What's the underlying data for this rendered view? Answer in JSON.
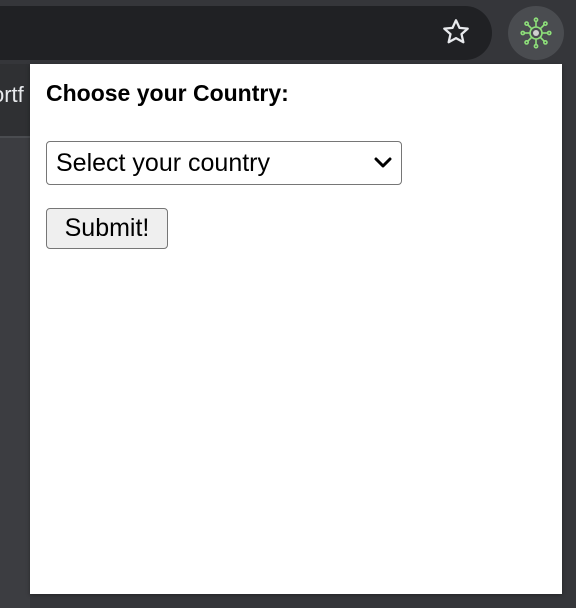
{
  "toolbar": {
    "star_icon": "star-outline-icon",
    "extension_icon": "virus-icon",
    "extension_icon_color": "#8ee07a"
  },
  "background_page": {
    "partial_text": "ortf"
  },
  "popup": {
    "heading": "Choose your Country:",
    "country_select": {
      "selected": "Select your country"
    },
    "submit_label": "Submit!"
  }
}
